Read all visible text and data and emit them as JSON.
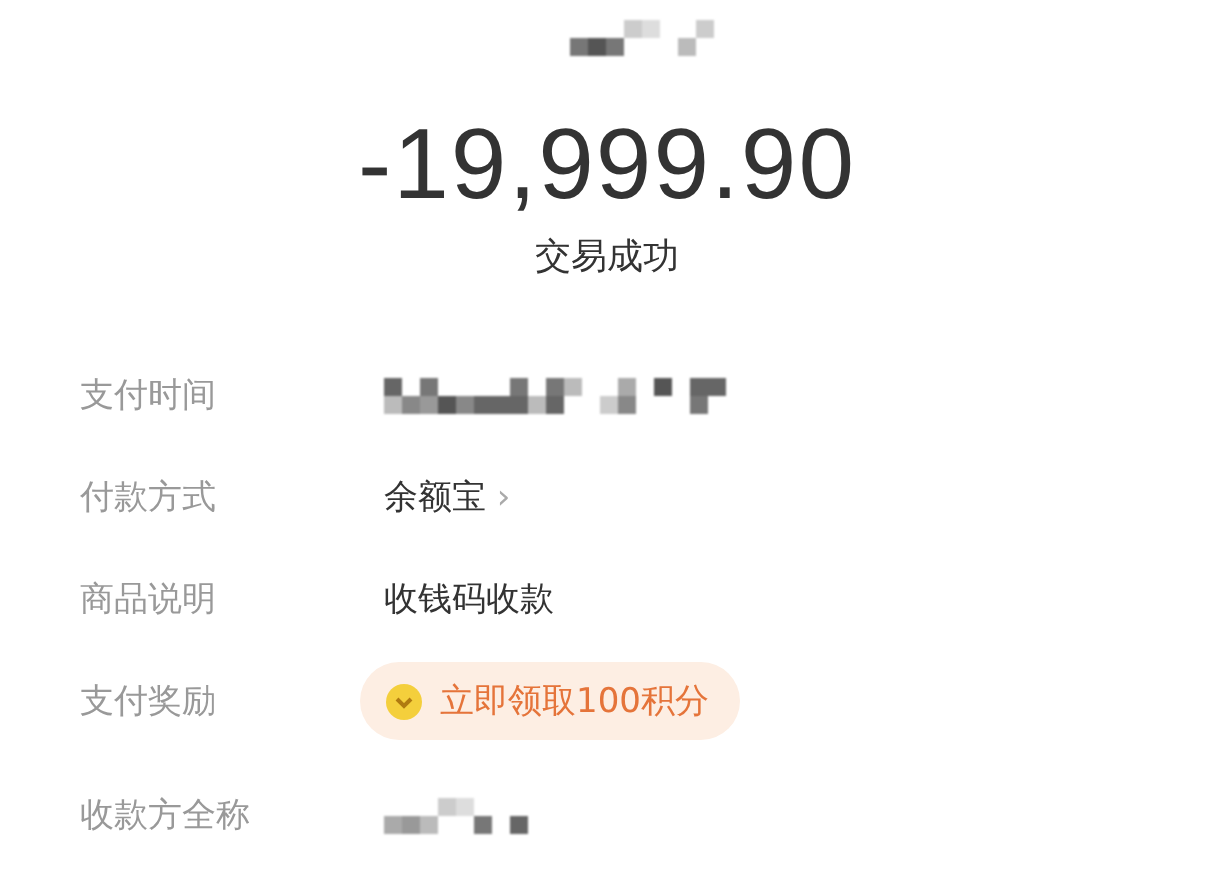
{
  "amount": "-19,999.90",
  "status": "交易成功",
  "rows": [
    {
      "label": "支付时间",
      "kind": "masked"
    },
    {
      "label": "付款方式",
      "kind": "link",
      "value": "余额宝",
      "chevron": "›"
    },
    {
      "label": "商品说明",
      "kind": "text",
      "value": "收钱码收款"
    },
    {
      "label": "支付奖励",
      "kind": "reward",
      "value": "立即领取100积分"
    },
    {
      "label": "收款方全称",
      "kind": "masked"
    }
  ]
}
